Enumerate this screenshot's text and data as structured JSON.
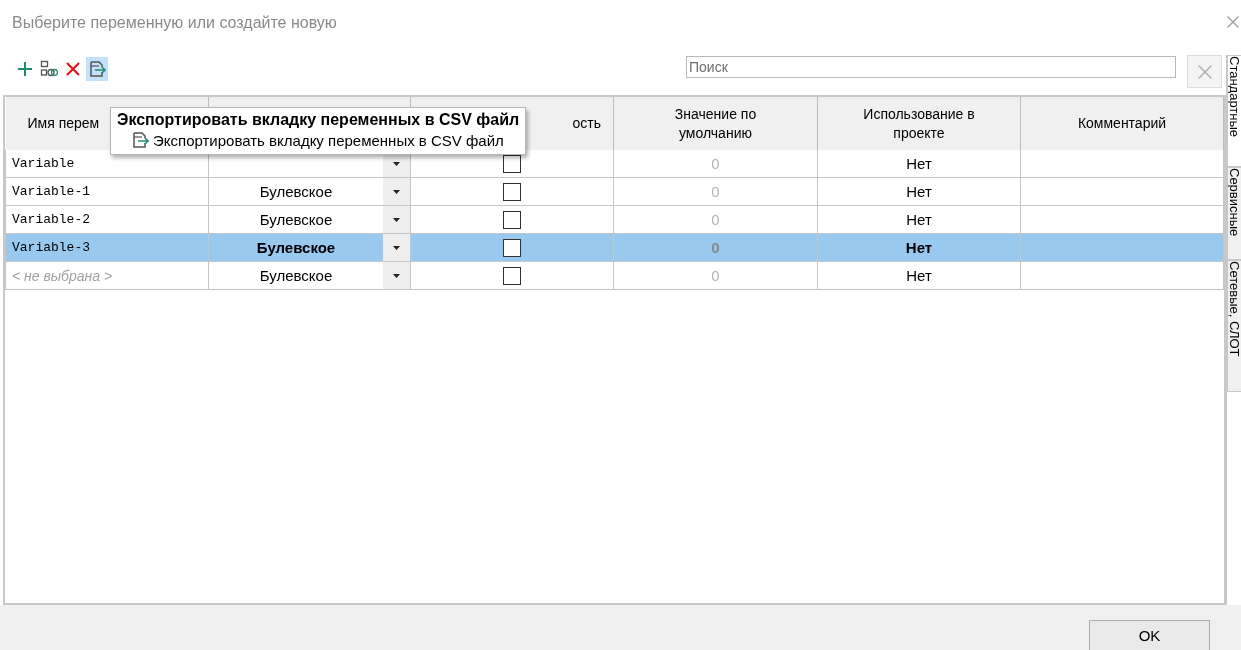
{
  "window": {
    "title": "Выберите переменную или создайте новую"
  },
  "toolbar": {
    "items": [
      {
        "kind": "add",
        "selected": false
      },
      {
        "kind": "link",
        "selected": false
      },
      {
        "kind": "delete",
        "selected": false
      },
      {
        "kind": "export",
        "selected": true
      }
    ]
  },
  "search": {
    "placeholder": "Поиск"
  },
  "table": {
    "columns": [
      {
        "label": "Имя перем"
      },
      {},
      {
        "label": "ость"
      },
      {
        "label": "Значение по умолчанию"
      },
      {
        "label": "Использование в проекте"
      },
      {
        "label": "Комментарий"
      }
    ],
    "rows": [
      {
        "name": "Variable",
        "unset": false,
        "checked": false,
        "default": "0",
        "usage": "Нет",
        "selected": false
      },
      {
        "name": "Variable-1",
        "unset": false,
        "type": "Булевское",
        "checked": false,
        "default": "0",
        "usage": "Нет",
        "selected": false
      },
      {
        "name": "Variable-2",
        "unset": false,
        "type": "Булевское",
        "checked": false,
        "default": "0",
        "usage": "Нет",
        "selected": false
      },
      {
        "name": "Variable-3",
        "unset": false,
        "type": "Булевское",
        "checked": false,
        "default": "0",
        "usage": "Нет",
        "selected": true
      },
      {
        "name": "< не выбрана >",
        "unset": true,
        "type": "Булевское",
        "checked": false,
        "default": "0",
        "usage": "Нет",
        "selected": false
      }
    ]
  },
  "tooltip": {
    "title": "Экспортировать вкладку переменных в CSV файл",
    "text": "Экспортировать вкладку переменных в CSV файл"
  },
  "side_tabs": [
    {
      "label": "Стандартные",
      "selected": true
    },
    {
      "label": "Сервисные",
      "selected": false
    },
    {
      "label": "Сетевые, СЛОТ",
      "selected": false
    }
  ],
  "buttons": [
    {
      "label": "OK"
    }
  ]
}
